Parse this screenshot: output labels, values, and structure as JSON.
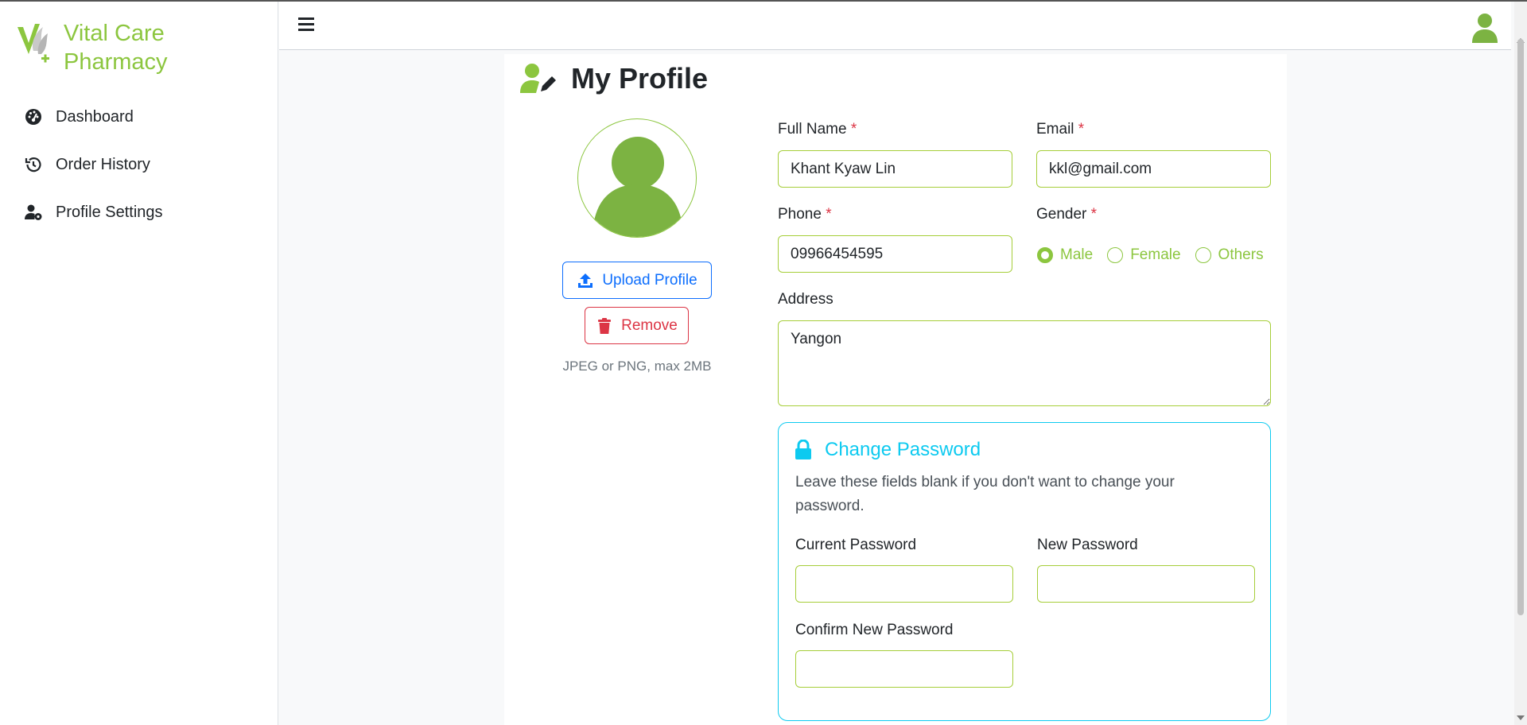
{
  "brand": {
    "line1": "Vital Care",
    "line2": "Pharmacy"
  },
  "sidebar": {
    "items": [
      {
        "label": "Dashboard",
        "icon": "gauge-icon"
      },
      {
        "label": "Order History",
        "icon": "history-icon"
      },
      {
        "label": "Profile Settings",
        "icon": "user-gear-icon"
      }
    ]
  },
  "page": {
    "title": "My Profile"
  },
  "avatar": {
    "upload_label": "Upload Profile",
    "remove_label": "Remove",
    "hint": "JPEG or PNG, max 2MB"
  },
  "form": {
    "full_name": {
      "label": "Full Name",
      "required": "*",
      "value": "Khant Kyaw Lin"
    },
    "email": {
      "label": "Email",
      "required": "*",
      "value": "kkl@gmail.com"
    },
    "phone": {
      "label": "Phone",
      "required": "*",
      "value": "09966454595"
    },
    "gender": {
      "label": "Gender",
      "required": "*",
      "options": [
        "Male",
        "Female",
        "Others"
      ],
      "selected": "Male"
    },
    "address": {
      "label": "Address",
      "value": "Yangon"
    }
  },
  "password": {
    "title": "Change Password",
    "description": "Leave these fields blank if you don't want to change your password.",
    "current_label": "Current Password",
    "new_label": "New Password",
    "confirm_label": "Confirm New Password"
  },
  "colors": {
    "brand_green": "#8cc63f",
    "input_border": "#a6ce39",
    "info": "#0dcaf0",
    "primary": "#0d6efd",
    "danger": "#dc3545"
  }
}
